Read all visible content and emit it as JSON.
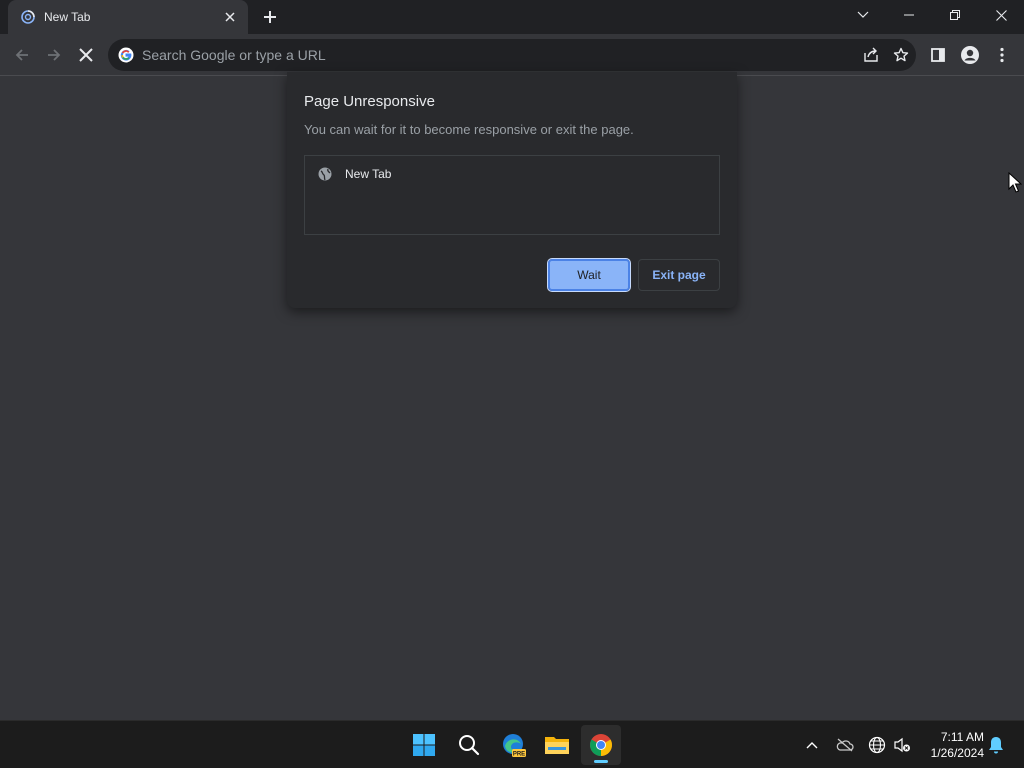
{
  "browser": {
    "tab": {
      "title": "New Tab"
    },
    "omnibox": {
      "placeholder": "Search Google or type a URL"
    }
  },
  "dialog": {
    "title": "Page Unresponsive",
    "message": "You can wait for it to become responsive or exit the page.",
    "pages": [
      {
        "label": "New Tab"
      }
    ],
    "wait_label": "Wait",
    "exit_label": "Exit page"
  },
  "taskbar": {
    "apps": [
      "start-icon",
      "search-icon",
      "edge-preview-icon",
      "file-explorer-icon",
      "chrome-icon"
    ],
    "clock": {
      "time": "7:11 AM",
      "date": "1/26/2024"
    }
  },
  "colors": {
    "accent": "#8ab4f8",
    "dialog_bg": "#292a2d",
    "page_bg": "#35363a",
    "titlebar_bg": "#202124"
  }
}
